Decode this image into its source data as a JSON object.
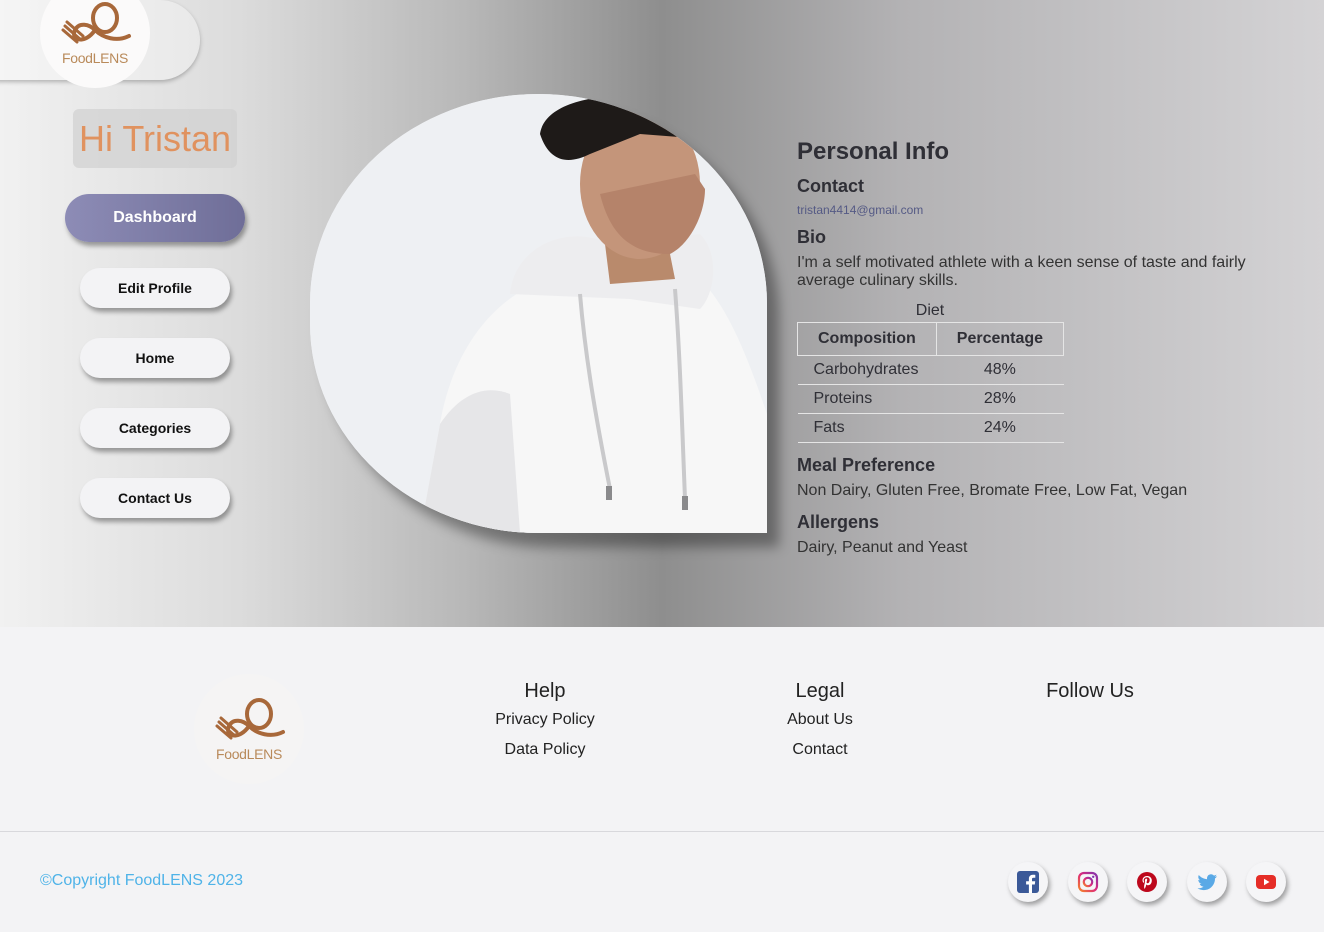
{
  "brand": {
    "logo_text": "FoodLENS"
  },
  "sidebar": {
    "greeting": "Hi Tristan",
    "nav": [
      {
        "label": "Dashboard"
      },
      {
        "label": "Edit Profile"
      },
      {
        "label": "Home"
      },
      {
        "label": "Categories"
      },
      {
        "label": "Contact Us"
      }
    ]
  },
  "profile": {
    "heading": "Personal Info",
    "contact_heading": "Contact",
    "email": "tristan4414@gmail.com",
    "bio_heading": "Bio",
    "bio": "I'm a self motivated athlete with a keen sense of taste and fairly average culinary skills.",
    "diet": {
      "caption": "Diet",
      "headers": [
        "Composition",
        "Percentage"
      ],
      "rows": [
        {
          "name": "Carbohydrates",
          "value": "48%"
        },
        {
          "name": "Proteins",
          "value": "28%"
        },
        {
          "name": "Fats",
          "value": "24%"
        }
      ]
    },
    "meal_heading": "Meal Preference",
    "meal": "Non Dairy, Gluten Free, Bromate Free, Low Fat, Vegan",
    "allergens_heading": "Allergens",
    "allergens": "Dairy, Peanut and Yeast"
  },
  "footer": {
    "help": {
      "title": "Help",
      "links": [
        "Privacy Policy",
        "Data Policy"
      ]
    },
    "legal": {
      "title": "Legal",
      "links": [
        "About Us",
        "Contact"
      ]
    },
    "follow": {
      "title": "Follow Us"
    },
    "copyright": "©Copyright FoodLENS 2023",
    "socials": [
      "facebook-icon",
      "instagram-icon",
      "pinterest-icon",
      "twitter-icon",
      "youtube-icon"
    ]
  },
  "colors": {
    "accent_orange": "#e0925f",
    "dashboard_button": "#7f7ea8",
    "copyright_blue": "#4fb3e8"
  }
}
